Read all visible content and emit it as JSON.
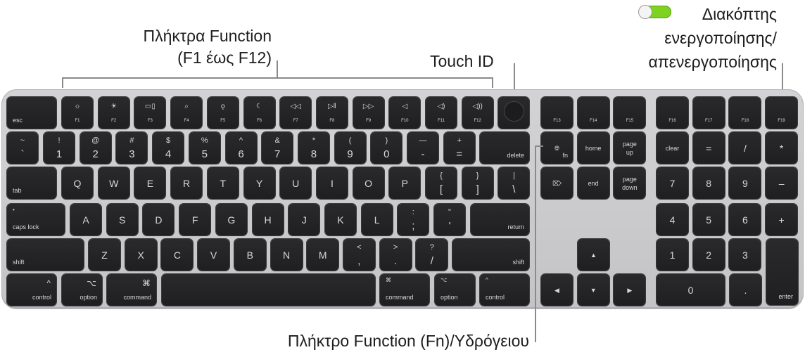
{
  "callouts": {
    "function_keys": [
      "Πλήκτρα Function",
      "(F1 έως F12)"
    ],
    "touch_id": "Touch ID",
    "power_switch": [
      "Διακόπτης",
      "ενεργοποίησης/",
      "απενεργοποίησης"
    ],
    "fn_globe_key": "Πλήκτρο Function (Fn)/Υδρόγειου"
  },
  "toggle": {
    "state": "on",
    "color": "#7ed321"
  },
  "keyboard": {
    "rows": [
      [
        {
          "kind": "mod",
          "bl": "esc"
        },
        {
          "kind": "fn",
          "i": "☼",
          "s": "F1"
        },
        {
          "kind": "fn",
          "i": "☀",
          "s": "F2"
        },
        {
          "kind": "fn",
          "i": "▭▯",
          "s": "F3"
        },
        {
          "kind": "fn",
          "i": "⌕",
          "s": "F4"
        },
        {
          "kind": "fn",
          "i": "ǫ",
          "s": "F5"
        },
        {
          "kind": "fn",
          "i": "☾",
          "s": "F6"
        },
        {
          "kind": "fn",
          "i": "◁◁",
          "s": "F7"
        },
        {
          "kind": "fn",
          "i": "▷‖",
          "s": "F8"
        },
        {
          "kind": "fn",
          "i": "▷▷",
          "s": "F9"
        },
        {
          "kind": "fn",
          "i": "◁",
          "s": "F10"
        },
        {
          "kind": "fn",
          "i": "◁)",
          "s": "F11"
        },
        {
          "kind": "fn",
          "i": "◁))",
          "s": "F12"
        },
        {
          "kind": "touchid"
        },
        {
          "kind": "fn",
          "i": "",
          "s": "F13"
        },
        {
          "kind": "fn",
          "i": "",
          "s": "F14"
        },
        {
          "kind": "fn",
          "i": "",
          "s": "F15"
        },
        {
          "kind": "fn",
          "i": "",
          "s": "F16"
        },
        {
          "kind": "fn",
          "i": "",
          "s": "F17"
        },
        {
          "kind": "fn",
          "i": "",
          "s": "F18"
        },
        {
          "kind": "fn",
          "i": "",
          "s": "F19"
        }
      ],
      [
        {
          "kind": "dual",
          "t": "~",
          "b": "`"
        },
        {
          "kind": "dual",
          "t": "!",
          "b": "1"
        },
        {
          "kind": "dual",
          "t": "@",
          "b": "2"
        },
        {
          "kind": "dual",
          "t": "#",
          "b": "3"
        },
        {
          "kind": "dual",
          "t": "$",
          "b": "4"
        },
        {
          "kind": "dual",
          "t": "%",
          "b": "5"
        },
        {
          "kind": "dual",
          "t": "^",
          "b": "6"
        },
        {
          "kind": "dual",
          "t": "&",
          "b": "7"
        },
        {
          "kind": "dual",
          "t": "*",
          "b": "8"
        },
        {
          "kind": "dual",
          "t": "(",
          "b": "9"
        },
        {
          "kind": "dual",
          "t": ")",
          "b": "0"
        },
        {
          "kind": "dual",
          "t": "—",
          "b": "-"
        },
        {
          "kind": "dual",
          "t": "+",
          "b": "="
        },
        {
          "kind": "mod",
          "br": "delete"
        },
        {
          "kind": "mod",
          "ctr": "🌐︎",
          "br": "fn"
        },
        {
          "kind": "mod",
          "ctr": "home"
        },
        {
          "kind": "mod",
          "ctr": "page\nup"
        },
        {
          "kind": "mod",
          "ctr": "clear"
        },
        {
          "kind": "letter",
          "c": "="
        },
        {
          "kind": "letter",
          "c": "/"
        },
        {
          "kind": "letter",
          "c": "*"
        }
      ],
      [
        {
          "kind": "mod",
          "bl": "tab"
        },
        {
          "kind": "letter",
          "c": "Q"
        },
        {
          "kind": "letter",
          "c": "W"
        },
        {
          "kind": "letter",
          "c": "E"
        },
        {
          "kind": "letter",
          "c": "R"
        },
        {
          "kind": "letter",
          "c": "T"
        },
        {
          "kind": "letter",
          "c": "Y"
        },
        {
          "kind": "letter",
          "c": "U"
        },
        {
          "kind": "letter",
          "c": "I"
        },
        {
          "kind": "letter",
          "c": "O"
        },
        {
          "kind": "letter",
          "c": "P"
        },
        {
          "kind": "dual",
          "t": "{",
          "b": "["
        },
        {
          "kind": "dual",
          "t": "}",
          "b": "]"
        },
        {
          "kind": "dual",
          "t": "|",
          "b": "\\"
        },
        {
          "kind": "mod",
          "ctr": "⌦"
        },
        {
          "kind": "mod",
          "ctr": "end"
        },
        {
          "kind": "mod",
          "ctr": "page\ndown"
        },
        {
          "kind": "letter",
          "c": "7"
        },
        {
          "kind": "letter",
          "c": "8"
        },
        {
          "kind": "letter",
          "c": "9"
        },
        {
          "kind": "letter",
          "c": "–"
        }
      ],
      [
        {
          "kind": "mod",
          "tl": "•",
          "bl": "caps lock"
        },
        {
          "kind": "letter",
          "c": "A"
        },
        {
          "kind": "letter",
          "c": "S"
        },
        {
          "kind": "letter",
          "c": "D"
        },
        {
          "kind": "letter",
          "c": "F"
        },
        {
          "kind": "letter",
          "c": "G"
        },
        {
          "kind": "letter",
          "c": "H"
        },
        {
          "kind": "letter",
          "c": "J"
        },
        {
          "kind": "letter",
          "c": "K"
        },
        {
          "kind": "letter",
          "c": "L"
        },
        {
          "kind": "dual",
          "t": ":",
          "b": ";"
        },
        {
          "kind": "dual",
          "t": "\"",
          "b": "'"
        },
        {
          "kind": "mod",
          "br": "return"
        },
        {
          "kind": "letter",
          "c": "4"
        },
        {
          "kind": "letter",
          "c": "5"
        },
        {
          "kind": "letter",
          "c": "6"
        },
        {
          "kind": "letter",
          "c": "+"
        }
      ],
      [
        {
          "kind": "mod",
          "bl": "shift"
        },
        {
          "kind": "letter",
          "c": "Z"
        },
        {
          "kind": "letter",
          "c": "X"
        },
        {
          "kind": "letter",
          "c": "C"
        },
        {
          "kind": "letter",
          "c": "V"
        },
        {
          "kind": "letter",
          "c": "B"
        },
        {
          "kind": "letter",
          "c": "N"
        },
        {
          "kind": "letter",
          "c": "M"
        },
        {
          "kind": "dual",
          "t": "<",
          "b": ","
        },
        {
          "kind": "dual",
          "t": ">",
          "b": "."
        },
        {
          "kind": "dual",
          "t": "?",
          "b": "/"
        },
        {
          "kind": "mod",
          "br": "shift"
        },
        {
          "kind": "mod",
          "ctr": "▲"
        },
        {
          "kind": "letter",
          "c": "1"
        },
        {
          "kind": "letter",
          "c": "2"
        },
        {
          "kind": "letter",
          "c": "3"
        },
        {
          "kind": "mod",
          "br": "enter"
        }
      ],
      [
        {
          "kind": "mod",
          "tr": "^",
          "br": "control"
        },
        {
          "kind": "mod",
          "tr": "⌥",
          "br": "option"
        },
        {
          "kind": "mod",
          "tr": "⌘",
          "br": "command"
        },
        {
          "kind": "mod"
        },
        {
          "kind": "mod",
          "tl": "⌘",
          "bl": "command"
        },
        {
          "kind": "mod",
          "tl": "⌥",
          "bl": "option"
        },
        {
          "kind": "mod",
          "tl": "^",
          "bl": "control"
        },
        {
          "kind": "mod",
          "ctr": "◀"
        },
        {
          "kind": "mod",
          "ctr": "▼"
        },
        {
          "kind": "mod",
          "ctr": "▶"
        },
        {
          "kind": "letter",
          "c": "0"
        },
        {
          "kind": "letter",
          "c": "."
        }
      ]
    ]
  }
}
